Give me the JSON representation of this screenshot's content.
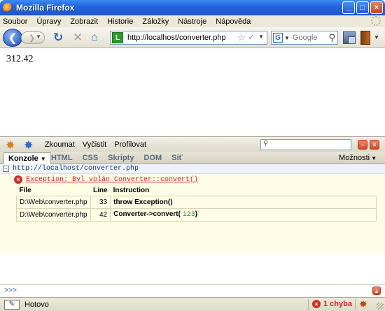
{
  "window": {
    "title": "Mozilla Firefox",
    "controls": {
      "minimize": "_",
      "maximize": "□",
      "close": "×"
    }
  },
  "menubar": {
    "items": [
      "Soubor",
      "Úpravy",
      "Zobrazit",
      "Historie",
      "Záložky",
      "Nástroje",
      "Nápověda"
    ]
  },
  "navbar": {
    "url": "http://localhost/converter.php",
    "site_icon_letter": "L",
    "search_engine_letter": "G",
    "search_placeholder": "Google"
  },
  "page": {
    "value": "312.42"
  },
  "firebug": {
    "toolbar_links": [
      "Zkoumat",
      "Vyčistit",
      "Profilovat"
    ],
    "active_tab": "Konzole",
    "tabs": [
      "HTML",
      "CSS",
      "Skripty",
      "DOM",
      "Síť"
    ],
    "options_label": "Možnosti",
    "console": {
      "source_url": "http://localhost/converter.php",
      "error_message": "Exception: Byl volán Converter::convert()",
      "columns": [
        "File",
        "Line",
        "Instruction"
      ],
      "rows": [
        {
          "file": "D:\\Web\\converter.php",
          "line": "33",
          "instruction": "throw Exception()",
          "arg": ""
        },
        {
          "file": "D:\\Web\\converter.php",
          "line": "42",
          "instruction": "Converter->convert(",
          "arg": "123",
          "close": ")"
        }
      ]
    },
    "command_prompt": ">>>"
  },
  "statusbar": {
    "text": "Hotovo",
    "error_count": "1 chyba"
  },
  "colors": {
    "titlebar": "#2466de",
    "error_red": "#d21f1f",
    "error_bg": "#fffde6"
  }
}
